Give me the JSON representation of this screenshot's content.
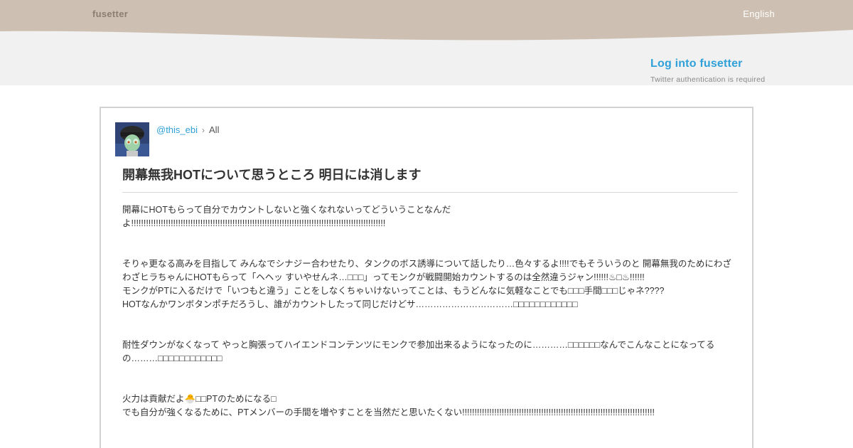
{
  "header": {
    "brand": "fusetter",
    "language": "English"
  },
  "login": {
    "link_label": "Log into fusetter",
    "note": "Twitter authentication is required"
  },
  "post": {
    "username": "@this_ebi",
    "separator": "›",
    "breadcrumb_all": "All",
    "title": "開幕無我HOTについて思うところ 明日には消します",
    "paragraphs": [
      "開幕にHOTもらって自分でカウントしないと強くなれないってどういうことなんだ\nよ!!!!!!!!!!!!!!!!!!!!!!!!!!!!!!!!!!!!!!!!!!!!!!!!!!!!!!!!!!!!!!!!!!!!!!!!!!!!!!!!!!!!!!!!!!!!!!!!!!!!!!!",
      "\nそりゃ更なる高みを目指して みんなでシナジー合わせたり、タンクのボス誘導について話したり…色々するよ!!!!でもそういうのと 開幕無我のためにわざわざヒラちゃんにHOTもらって「ヘヘッ すいやせんネ…□□□」ってモンクが戦闘開始カウントするのは全然違うジャン!!!!!!♨□♨!!!!!!\nモンクがPTに入るだけで「いつもと違う」ことをしなくちゃいけないってことは、もうどんなに気軽なことでも□□□手間□□□じゃネ????\nHOTなんかワンボタンポチだろうし、誰がカウントしたって同じだけどサ……………………………□□□□□□□□□□□□",
      "\n耐性ダウンがなくなって やっと胸張ってハイエンドコンテンツにモンクで参加出来るようになったのに…………□□□□□□なんでこんなことになってるの………□□□□□□□□□□□□",
      "\n火力は貢献だよ🐣□□PTのためになる□\nでも自分が強くなるために、PTメンバーの手間を増やすことを当然だと思いたくない!!!!!!!!!!!!!!!!!!!!!!!!!!!!!!!!!!!!!!!!!!!!!!!!!!!!!!!!!!!!!!!!!!!!!!!!!!!!!!"
    ]
  },
  "colors": {
    "header_band": "#cdbfb1",
    "sub_band": "#f1f1f1",
    "link": "#2fa0d8",
    "card_border": "#d2d2d2"
  }
}
